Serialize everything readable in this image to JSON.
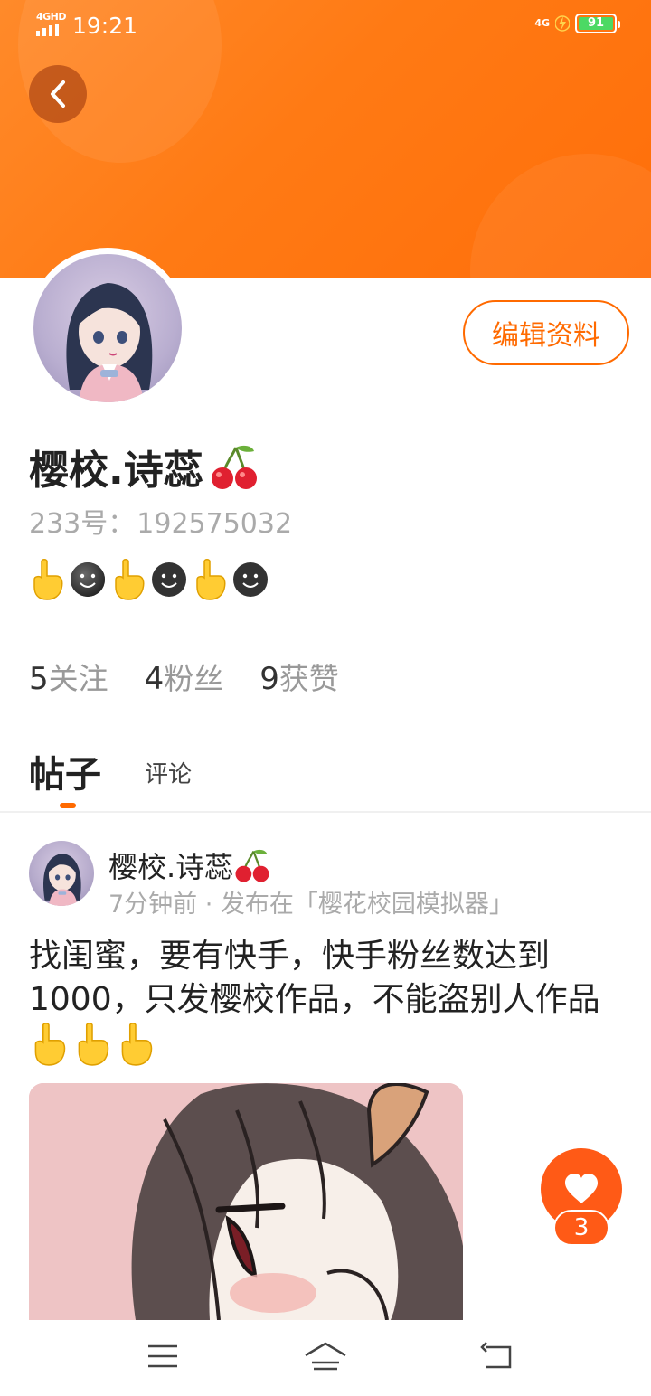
{
  "status_bar": {
    "network_left": "4GHD",
    "time": "19:21",
    "network_right": "4G",
    "battery": "91",
    "colors": {
      "battery_fill": "#4cd964"
    }
  },
  "header": {
    "back_icon": "chevron-left-icon",
    "colors": {
      "banner": "#ff7a14"
    }
  },
  "profile": {
    "edit_button_label": "编辑资料",
    "name": "樱校.诗蕊",
    "name_emoji": "cherry-icon",
    "id_label": "233号：",
    "id_value": "192575032",
    "bio_icons": [
      "pointing-up-icon",
      "smile-face-icon",
      "pointing-up-icon",
      "smile-face-icon",
      "pointing-up-icon",
      "smile-face-icon"
    ],
    "accent_color": "#ff6a00"
  },
  "stats": {
    "following_count": "5",
    "following_label": "关注",
    "fans_count": "4",
    "fans_label": "粉丝",
    "likes_count": "9",
    "likes_label": "获赞"
  },
  "tabs": {
    "posts": "帖子",
    "comments": "评论",
    "active": "posts"
  },
  "post": {
    "author": "樱校.诗蕊",
    "meta": "7分钟前 · 发布在「樱花校园模拟器」",
    "text": "找闺蜜，要有快手，快手粉丝数达到1000，只发樱校作品，不能盗别人作品",
    "text_emojis": [
      "pointing-up-icon",
      "pointing-up-icon",
      "pointing-up-icon"
    ],
    "like_count": "3"
  },
  "nav_bar": {
    "menu_icon": "menu-icon",
    "home_icon": "home-icon",
    "back_icon": "back-icon"
  }
}
